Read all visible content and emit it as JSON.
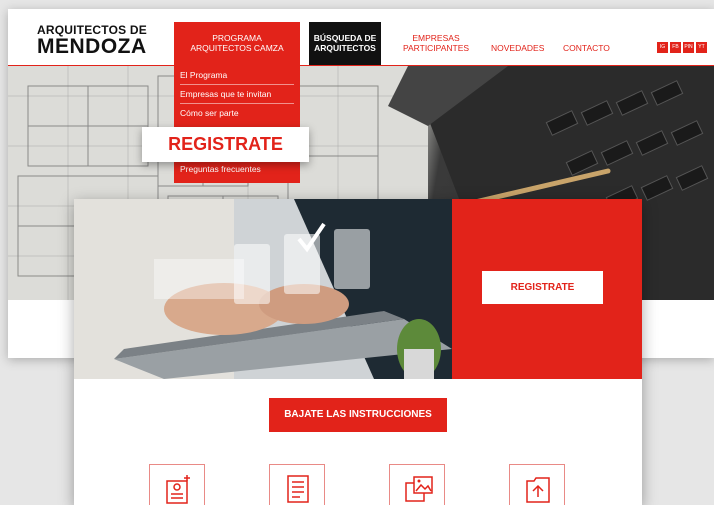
{
  "brand": {
    "line1": "ARQUITECTOS DE",
    "line2": "MENDOZA"
  },
  "nav": {
    "programa": [
      "PROGRAMA",
      "ARQUITECTOS CAMZA"
    ],
    "busqueda": [
      "BÚSQUEDA DE",
      "ARQUITECTOS"
    ],
    "empresas": [
      "EMPRESAS",
      "PARTICIPANTES"
    ],
    "novedades": "NOVEDADES",
    "contacto": "CONTACTO",
    "social": [
      "IG",
      "FB",
      "PIN",
      "YT"
    ]
  },
  "dropdown": {
    "items": [
      "El Programa",
      "Empresas que te invitan",
      "Cómo ser parte",
      "Preguntas frecuentes"
    ]
  },
  "hero": {
    "register_label": "REGISTRATE"
  },
  "front": {
    "register_label": "REGISTRATE",
    "instructions_label": "BAJATE LAS INSTRUCCIONES",
    "icons": [
      "id-card-icon",
      "form-document-icon",
      "media-upload-icon",
      "folder-upload-icon"
    ]
  },
  "colors": {
    "accent": "#e2231a",
    "dark": "#111111"
  }
}
